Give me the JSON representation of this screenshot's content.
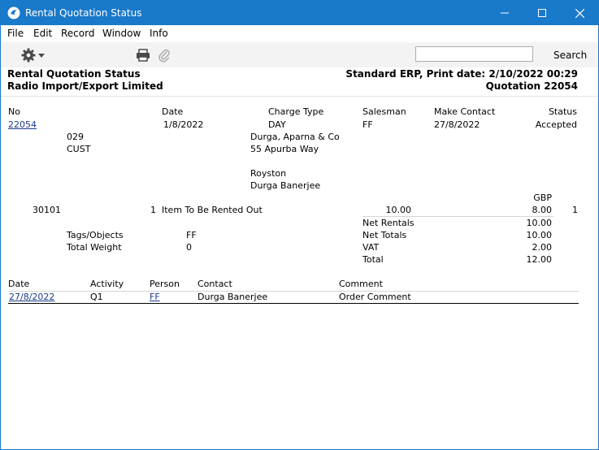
{
  "window": {
    "title": "Rental Quotation Status",
    "controls": [
      "minimize-icon",
      "maximize-icon",
      "close-icon"
    ]
  },
  "menu": [
    "File",
    "Edit",
    "Record",
    "Window",
    "Info"
  ],
  "toolbar": {
    "search_placeholder": "",
    "search_label": "Search",
    "icons": [
      "gear-icon",
      "printer-icon",
      "paperclip-icon"
    ]
  },
  "report_header": {
    "title": "Rental Quotation Status",
    "company": "Radio Import/Export Limited",
    "print_info": "Standard ERP, Print date: 2/10/2022 00:29",
    "doc_ref": "Quotation 22054"
  },
  "columns": {
    "no": "No",
    "date": "Date",
    "charge_type": "Charge Type",
    "salesman": "Salesman",
    "make_contact": "Make Contact",
    "status": "Status"
  },
  "record": {
    "no": "22054",
    "date": "1/8/2022",
    "charge_type": "DAY",
    "salesman": "FF",
    "make_contact": "27/8/2022",
    "status": "Accepted",
    "code1": "029",
    "code2": "CUST",
    "customer_name": "Durga, Aparna & Co",
    "address": "55 Apurba Way",
    "city": "Royston",
    "contact": "Durga Banerjee",
    "currency": "GBP"
  },
  "line": {
    "item": "30101",
    "qty": "1",
    "description": "Item To Be Rented Out",
    "price": "10.00",
    "sum": "8.00",
    "extra": "1"
  },
  "totals": {
    "net_rentals_label": "Net Rentals",
    "net_rentals": "10.00",
    "net_totals_label": "Net Totals",
    "net_totals": "10.00",
    "vat_label": "VAT",
    "vat": "2.00",
    "total_label": "Total",
    "total": "12.00"
  },
  "extra": {
    "tags_label": "Tags/Objects",
    "tags": "FF",
    "weight_label": "Total Weight",
    "weight": "0"
  },
  "activities": {
    "headers": {
      "date": "Date",
      "activity": "Activity",
      "person": "Person",
      "contact": "Contact",
      "comment": "Comment"
    },
    "rows": [
      {
        "date": "27/8/2022",
        "activity": "Q1",
        "person": "FF",
        "contact": "Durga Banerjee",
        "comment": "Order Comment"
      }
    ]
  }
}
